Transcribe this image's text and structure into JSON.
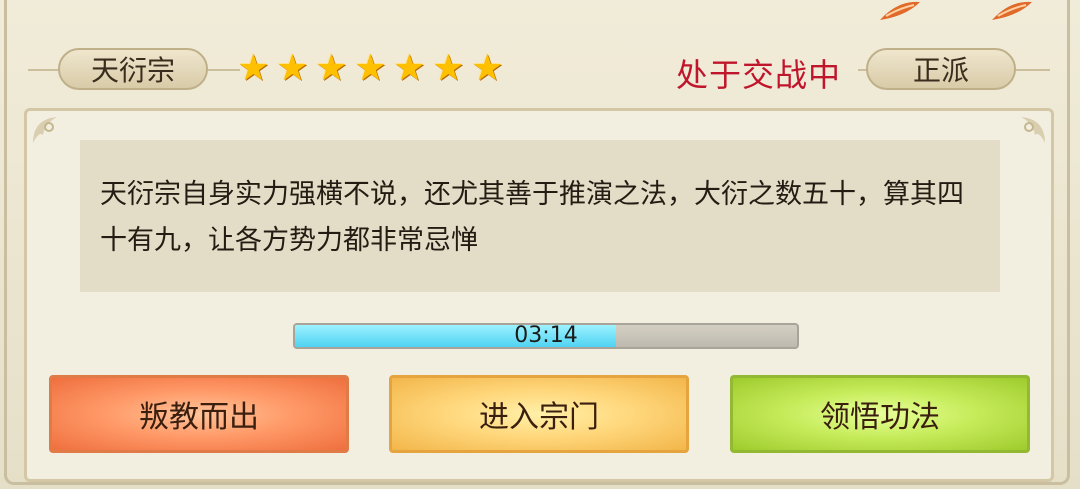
{
  "sect": {
    "name": "天衍宗",
    "stars": [
      "★",
      "★",
      "★",
      "★",
      "★",
      "★",
      "★"
    ],
    "status": "处于交战中",
    "alignment": "正派",
    "description": "天衍宗自身实力强横不说，还尤其善于推演之法，大衍之数五十，算其四十有九，让各方势力都非常忌惮"
  },
  "progress": {
    "label": "03:14",
    "fraction": 0.64
  },
  "buttons": {
    "defect": "叛教而出",
    "enter": "进入宗门",
    "comprehend": "领悟功法"
  },
  "colors": {
    "status": "#c0162c",
    "star": "#ffc000",
    "progress_fill": "#4fd3f2"
  }
}
